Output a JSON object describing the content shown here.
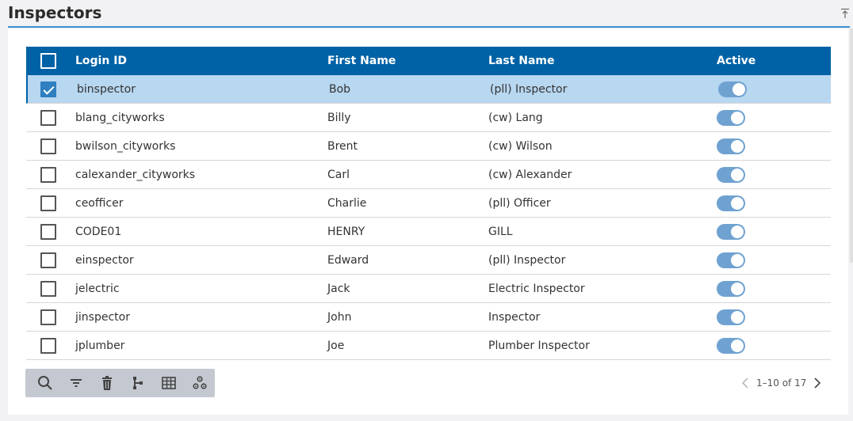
{
  "header": {
    "title": "Inspectors"
  },
  "table": {
    "columns": [
      "Login ID",
      "First Name",
      "Last Name",
      "Active"
    ],
    "rows": [
      {
        "login": "binspector",
        "first": "Bob",
        "last": "(pll) Inspector",
        "selected": true,
        "active": true
      },
      {
        "login": "blang_cityworks",
        "first": "Billy",
        "last": "(cw) Lang",
        "selected": false,
        "active": true
      },
      {
        "login": "bwilson_cityworks",
        "first": "Brent",
        "last": "(cw) Wilson",
        "selected": false,
        "active": true
      },
      {
        "login": "calexander_cityworks",
        "first": "Carl",
        "last": "(cw) Alexander",
        "selected": false,
        "active": true
      },
      {
        "login": "ceofficer",
        "first": "Charlie",
        "last": "(pll) Officer",
        "selected": false,
        "active": true
      },
      {
        "login": "CODE01",
        "first": "HENRY",
        "last": "GILL",
        "selected": false,
        "active": true
      },
      {
        "login": "einspector",
        "first": "Edward",
        "last": "(pll) Inspector",
        "selected": false,
        "active": true
      },
      {
        "login": "jelectric",
        "first": "Jack",
        "last": "Electric Inspector",
        "selected": false,
        "active": true
      },
      {
        "login": "jinspector",
        "first": "John",
        "last": "Inspector",
        "selected": false,
        "active": true
      },
      {
        "login": "jplumber",
        "first": "Joe",
        "last": "Plumber Inspector",
        "selected": false,
        "active": true
      }
    ]
  },
  "toolbar": {
    "icons": [
      "search-icon",
      "filter-icon",
      "trash-icon",
      "hierarchy-icon",
      "table-icon",
      "settings-cluster-icon"
    ]
  },
  "pager": {
    "label": "1–10 of 17"
  },
  "colors": {
    "header_bg": "#0062a6",
    "selected_row": "#b8d7f0",
    "toggle_on": "#6fa2d1",
    "accent_line": "#3a8fd4"
  }
}
